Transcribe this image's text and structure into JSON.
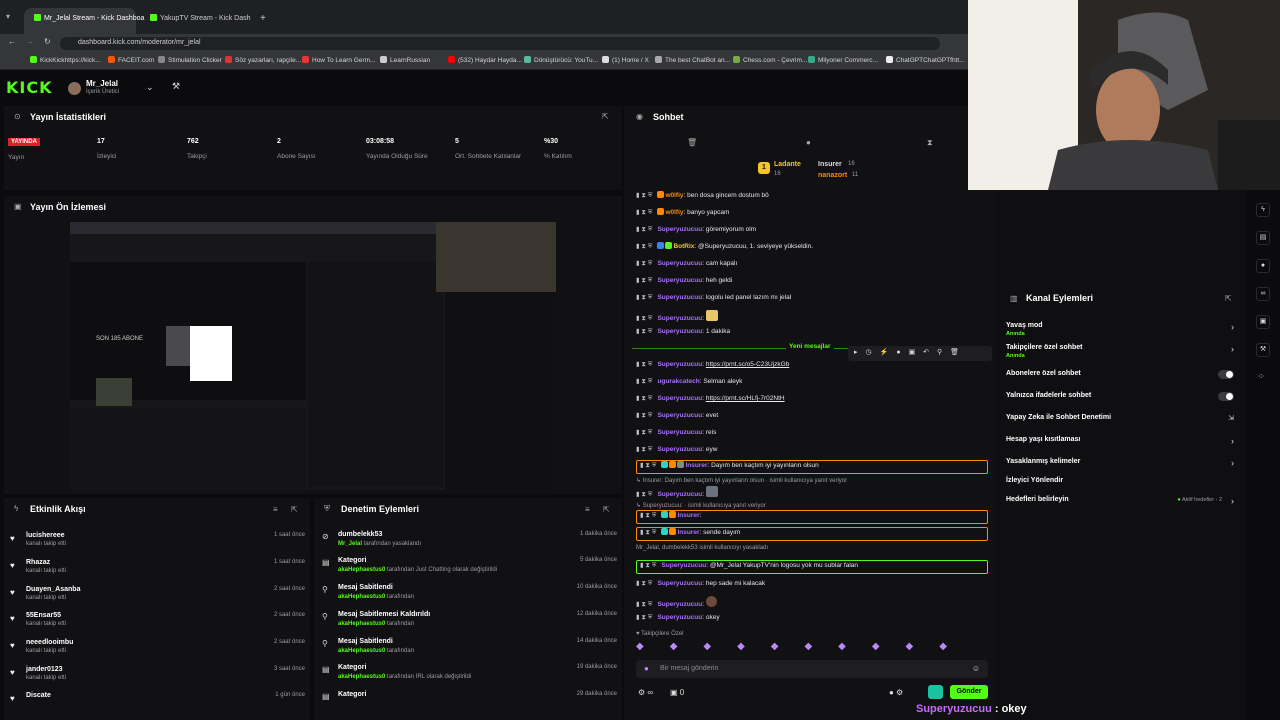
{
  "browser": {
    "tabs": [
      {
        "label": "Mr_Jelal Stream - Kick Dashboa",
        "active": true
      },
      {
        "label": "YakupTV Stream - Kick Dash",
        "active": false
      }
    ],
    "url": "dashboard.kick.com/moderator/mr_jelal",
    "bookmarks": [
      "KickKickhttps://kick...",
      "FACEIT.com",
      "Stimulation Clicker",
      "Söz yazarları, rapçile...",
      "How To Learn Germ...",
      "LearnRussian",
      "(532) Haydar Hayda...",
      "Dönüştürücü: YouTu...",
      "(1) Home / X",
      "The best ChatBot an...",
      "Chess.com - Çevrim...",
      "Milyoner Commerc...",
      "ChatGPTChatGPTfhtt..."
    ]
  },
  "header": {
    "logo": "KICK",
    "user_name": "Mr_Jelal",
    "user_role": "İçerik Üretici"
  },
  "stats": {
    "title": "Yayın İstatistikleri",
    "live_badge": "YAYINDA",
    "items": [
      {
        "value": "",
        "label": "Yayın"
      },
      {
        "value": "17",
        "label": "İzleyici"
      },
      {
        "value": "762",
        "label": "Takipçi"
      },
      {
        "value": "2",
        "label": "Abone Sayısı"
      },
      {
        "value": "03:08:58",
        "label": "Yayında Olduğu Süre"
      },
      {
        "value": "5",
        "label": "Ort. Sohbete Katılanlar"
      },
      {
        "value": "%30",
        "label": "% Katılım"
      }
    ]
  },
  "preview": {
    "title": "Yayın Ön İzlemesi",
    "inner_text": "SON 185 ABONE"
  },
  "activity": {
    "title": "Etkinlik Akışı",
    "items": [
      {
        "name": "lucishereee",
        "sub": "kanalı takip etti",
        "time": "1 saat önce"
      },
      {
        "name": "Rhazaz",
        "sub": "kanalı takip etti",
        "time": "1 saat önce"
      },
      {
        "name": "Duayen_Asanba",
        "sub": "kanalı takip etti",
        "time": "2 saat önce"
      },
      {
        "name": "55Ensar55",
        "sub": "kanalı takip etti",
        "time": "2 saat önce"
      },
      {
        "name": "neeedlooimbu",
        "sub": "kanalı takip etti",
        "time": "2 saat önce"
      },
      {
        "name": "jander0123",
        "sub": "kanalı takip etti",
        "time": "3 saat önce"
      },
      {
        "name": "Discate",
        "sub": "",
        "time": "1 gün önce"
      }
    ]
  },
  "moderation": {
    "title": "Denetim Eylemleri",
    "items": [
      {
        "name": "dumbelekk53",
        "user": "Mr_Jelal",
        "sub": "tarafından yasaklandı",
        "time": "1 dakika önce"
      },
      {
        "name": "Kategori",
        "user": "akaHephaestus0",
        "sub": "tarafından Just Chatting olarak değiştirildi",
        "time": "5 dakika önce"
      },
      {
        "name": "Mesaj Sabitlendi",
        "user": "akaHephaestus0",
        "sub": "tarafından",
        "time": "10 dakika önce"
      },
      {
        "name": "Mesaj Sabitlemesi Kaldırıldı",
        "user": "akaHephaestus0",
        "sub": "tarafından",
        "time": "12 dakika önce"
      },
      {
        "name": "Mesaj Sabitlendi",
        "user": "akaHephaestus0",
        "sub": "tarafından",
        "time": "14 dakika önce"
      },
      {
        "name": "Kategori",
        "user": "akaHephaestus0",
        "sub": "tarafından IRL olarak değiştirildi",
        "time": "19 dakika önce"
      },
      {
        "name": "Kategori",
        "user": "",
        "sub": "",
        "time": "29 dakika önce"
      }
    ]
  },
  "chat": {
    "title": "Sohbet",
    "top_viewers": [
      {
        "name": "Ladante",
        "count": "16"
      },
      {
        "name": "Insurer",
        "count": "16"
      },
      {
        "name": "nanazort",
        "count": "11"
      }
    ],
    "new_messages": "Yeni mesajlar",
    "messages": [
      {
        "user": "w0lfiy",
        "text": "ben dosa gincem dostum bö"
      },
      {
        "user": "w0lfiy",
        "text": "banyo yapcam"
      },
      {
        "user": "Superyuzucuu",
        "text": "göremiyorum olm"
      },
      {
        "user": "BotRix",
        "text": "@Superyuzucuu, 1. seviyeye yükseldin."
      },
      {
        "user": "Superyuzucuu",
        "text": "cam kapalı"
      },
      {
        "user": "Superyuzucuu",
        "text": "heh geldi"
      },
      {
        "user": "Superyuzucuu",
        "text": "logolu led panel lazım mı jelal"
      },
      {
        "user": "Superyuzucuu",
        "text": ""
      },
      {
        "user": "Superyuzucuu",
        "text": "1 dakika"
      },
      {
        "user": "Superyuzucuu",
        "text": "https://prnt.sc/o5-C23UjzkGb"
      },
      {
        "user": "ugurakcatech",
        "text": "Selman aleyk"
      },
      {
        "user": "Superyuzucuu",
        "text": "https://prnt.sc/HLfj-7r02NtH"
      },
      {
        "user": "Superyuzucuu",
        "text": "evet"
      },
      {
        "user": "Superyuzucuu",
        "text": "reis"
      },
      {
        "user": "Superyuzucuu",
        "text": "eyw"
      },
      {
        "user": "Insurer",
        "text": "Dayım ben kaçtım iyi yayınların olsun"
      },
      {
        "user": "Superyuzucuu",
        "text": ""
      },
      {
        "user": "Insurer",
        "text": ""
      },
      {
        "user": "Insurer",
        "text": "sende dayım"
      },
      {
        "user": "Superyuzucuu",
        "text": "@Mr_Jelal YakupTV'nin logosu yok mu sublar falan"
      },
      {
        "user": "Superyuzucuu",
        "text": "hep sade mi kalacak"
      },
      {
        "user": "Superyuzucuu",
        "text": ""
      },
      {
        "user": "Superyuzucuu",
        "text": "okey"
      }
    ],
    "reply_1": "Insurer: Dayım ben kaçtım iyi yayınların olsun",
    "reply_1_suffix": "isimli kullanıcıya yanıt veriyor",
    "reply_2": "Superyuzucuu:",
    "reply_2_suffix": "isimli kullanıcıya yanıt veriyor",
    "ban_notice": "Mr_Jelal, dumbelekk53 isimli kullanıcıyı yasakladı",
    "followers_only": "Takipçilere Özel",
    "input_placeholder": "Bir mesaj gönderin",
    "send_label": "Gönder",
    "counter": "0"
  },
  "channel_actions": {
    "title": "Kanal Eylemleri",
    "items": [
      {
        "label": "Yavaş mod",
        "sub": "Anında",
        "control": "chevron"
      },
      {
        "label": "Takipçilere özel sohbet",
        "sub": "Anında",
        "control": "chevron"
      },
      {
        "label": "Abonelere özel sohbet",
        "sub": "",
        "control": "toggle"
      },
      {
        "label": "Yalnızca ifadelerle sohbet",
        "sub": "",
        "control": "toggle"
      },
      {
        "label": "Yapay Zeka ile Sohbet Denetimi",
        "sub": "",
        "control": "external"
      },
      {
        "label": "Hesap yaşı kısıtlaması",
        "sub": "",
        "control": "chevron"
      },
      {
        "label": "Yasaklanmış kelimeler",
        "sub": "",
        "control": "chevron"
      },
      {
        "label": "İzleyici Yönlendir",
        "sub": "",
        "control": "none"
      },
      {
        "label": "Hedefleri belirleyin",
        "sub": "",
        "control": "chevron"
      }
    ],
    "goals_status": "Aktif hedefler - 2"
  },
  "overlay": {
    "user": "Superyuzucuu",
    "text": " : okey"
  },
  "colors": {
    "kick_green": "#53fc18",
    "username_purple": "#a970ff",
    "live_red": "#e11d2b",
    "highlight_orange": "#ff8a00"
  }
}
